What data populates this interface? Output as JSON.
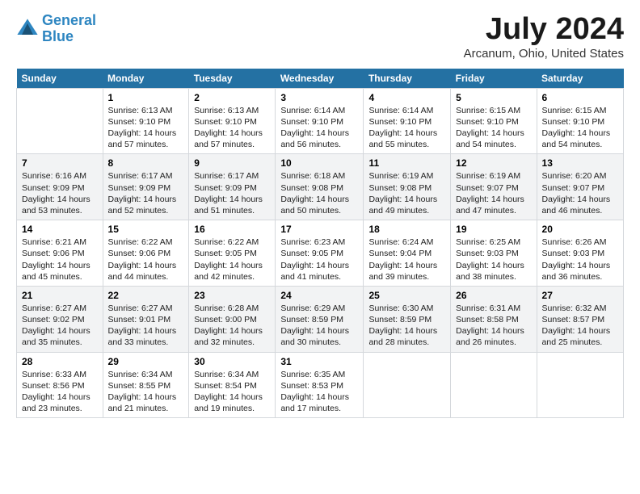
{
  "header": {
    "logo_line1": "General",
    "logo_line2": "Blue",
    "main_title": "July 2024",
    "subtitle": "Arcanum, Ohio, United States"
  },
  "days_of_week": [
    "Sunday",
    "Monday",
    "Tuesday",
    "Wednesday",
    "Thursday",
    "Friday",
    "Saturday"
  ],
  "weeks": [
    [
      {
        "num": "",
        "sunrise": "",
        "sunset": "",
        "daylight": ""
      },
      {
        "num": "1",
        "sunrise": "Sunrise: 6:13 AM",
        "sunset": "Sunset: 9:10 PM",
        "daylight": "Daylight: 14 hours and 57 minutes."
      },
      {
        "num": "2",
        "sunrise": "Sunrise: 6:13 AM",
        "sunset": "Sunset: 9:10 PM",
        "daylight": "Daylight: 14 hours and 57 minutes."
      },
      {
        "num": "3",
        "sunrise": "Sunrise: 6:14 AM",
        "sunset": "Sunset: 9:10 PM",
        "daylight": "Daylight: 14 hours and 56 minutes."
      },
      {
        "num": "4",
        "sunrise": "Sunrise: 6:14 AM",
        "sunset": "Sunset: 9:10 PM",
        "daylight": "Daylight: 14 hours and 55 minutes."
      },
      {
        "num": "5",
        "sunrise": "Sunrise: 6:15 AM",
        "sunset": "Sunset: 9:10 PM",
        "daylight": "Daylight: 14 hours and 54 minutes."
      },
      {
        "num": "6",
        "sunrise": "Sunrise: 6:15 AM",
        "sunset": "Sunset: 9:10 PM",
        "daylight": "Daylight: 14 hours and 54 minutes."
      }
    ],
    [
      {
        "num": "7",
        "sunrise": "Sunrise: 6:16 AM",
        "sunset": "Sunset: 9:09 PM",
        "daylight": "Daylight: 14 hours and 53 minutes."
      },
      {
        "num": "8",
        "sunrise": "Sunrise: 6:17 AM",
        "sunset": "Sunset: 9:09 PM",
        "daylight": "Daylight: 14 hours and 52 minutes."
      },
      {
        "num": "9",
        "sunrise": "Sunrise: 6:17 AM",
        "sunset": "Sunset: 9:09 PM",
        "daylight": "Daylight: 14 hours and 51 minutes."
      },
      {
        "num": "10",
        "sunrise": "Sunrise: 6:18 AM",
        "sunset": "Sunset: 9:08 PM",
        "daylight": "Daylight: 14 hours and 50 minutes."
      },
      {
        "num": "11",
        "sunrise": "Sunrise: 6:19 AM",
        "sunset": "Sunset: 9:08 PM",
        "daylight": "Daylight: 14 hours and 49 minutes."
      },
      {
        "num": "12",
        "sunrise": "Sunrise: 6:19 AM",
        "sunset": "Sunset: 9:07 PM",
        "daylight": "Daylight: 14 hours and 47 minutes."
      },
      {
        "num": "13",
        "sunrise": "Sunrise: 6:20 AM",
        "sunset": "Sunset: 9:07 PM",
        "daylight": "Daylight: 14 hours and 46 minutes."
      }
    ],
    [
      {
        "num": "14",
        "sunrise": "Sunrise: 6:21 AM",
        "sunset": "Sunset: 9:06 PM",
        "daylight": "Daylight: 14 hours and 45 minutes."
      },
      {
        "num": "15",
        "sunrise": "Sunrise: 6:22 AM",
        "sunset": "Sunset: 9:06 PM",
        "daylight": "Daylight: 14 hours and 44 minutes."
      },
      {
        "num": "16",
        "sunrise": "Sunrise: 6:22 AM",
        "sunset": "Sunset: 9:05 PM",
        "daylight": "Daylight: 14 hours and 42 minutes."
      },
      {
        "num": "17",
        "sunrise": "Sunrise: 6:23 AM",
        "sunset": "Sunset: 9:05 PM",
        "daylight": "Daylight: 14 hours and 41 minutes."
      },
      {
        "num": "18",
        "sunrise": "Sunrise: 6:24 AM",
        "sunset": "Sunset: 9:04 PM",
        "daylight": "Daylight: 14 hours and 39 minutes."
      },
      {
        "num": "19",
        "sunrise": "Sunrise: 6:25 AM",
        "sunset": "Sunset: 9:03 PM",
        "daylight": "Daylight: 14 hours and 38 minutes."
      },
      {
        "num": "20",
        "sunrise": "Sunrise: 6:26 AM",
        "sunset": "Sunset: 9:03 PM",
        "daylight": "Daylight: 14 hours and 36 minutes."
      }
    ],
    [
      {
        "num": "21",
        "sunrise": "Sunrise: 6:27 AM",
        "sunset": "Sunset: 9:02 PM",
        "daylight": "Daylight: 14 hours and 35 minutes."
      },
      {
        "num": "22",
        "sunrise": "Sunrise: 6:27 AM",
        "sunset": "Sunset: 9:01 PM",
        "daylight": "Daylight: 14 hours and 33 minutes."
      },
      {
        "num": "23",
        "sunrise": "Sunrise: 6:28 AM",
        "sunset": "Sunset: 9:00 PM",
        "daylight": "Daylight: 14 hours and 32 minutes."
      },
      {
        "num": "24",
        "sunrise": "Sunrise: 6:29 AM",
        "sunset": "Sunset: 8:59 PM",
        "daylight": "Daylight: 14 hours and 30 minutes."
      },
      {
        "num": "25",
        "sunrise": "Sunrise: 6:30 AM",
        "sunset": "Sunset: 8:59 PM",
        "daylight": "Daylight: 14 hours and 28 minutes."
      },
      {
        "num": "26",
        "sunrise": "Sunrise: 6:31 AM",
        "sunset": "Sunset: 8:58 PM",
        "daylight": "Daylight: 14 hours and 26 minutes."
      },
      {
        "num": "27",
        "sunrise": "Sunrise: 6:32 AM",
        "sunset": "Sunset: 8:57 PM",
        "daylight": "Daylight: 14 hours and 25 minutes."
      }
    ],
    [
      {
        "num": "28",
        "sunrise": "Sunrise: 6:33 AM",
        "sunset": "Sunset: 8:56 PM",
        "daylight": "Daylight: 14 hours and 23 minutes."
      },
      {
        "num": "29",
        "sunrise": "Sunrise: 6:34 AM",
        "sunset": "Sunset: 8:55 PM",
        "daylight": "Daylight: 14 hours and 21 minutes."
      },
      {
        "num": "30",
        "sunrise": "Sunrise: 6:34 AM",
        "sunset": "Sunset: 8:54 PM",
        "daylight": "Daylight: 14 hours and 19 minutes."
      },
      {
        "num": "31",
        "sunrise": "Sunrise: 6:35 AM",
        "sunset": "Sunset: 8:53 PM",
        "daylight": "Daylight: 14 hours and 17 minutes."
      },
      {
        "num": "",
        "sunrise": "",
        "sunset": "",
        "daylight": ""
      },
      {
        "num": "",
        "sunrise": "",
        "sunset": "",
        "daylight": ""
      },
      {
        "num": "",
        "sunrise": "",
        "sunset": "",
        "daylight": ""
      }
    ]
  ]
}
